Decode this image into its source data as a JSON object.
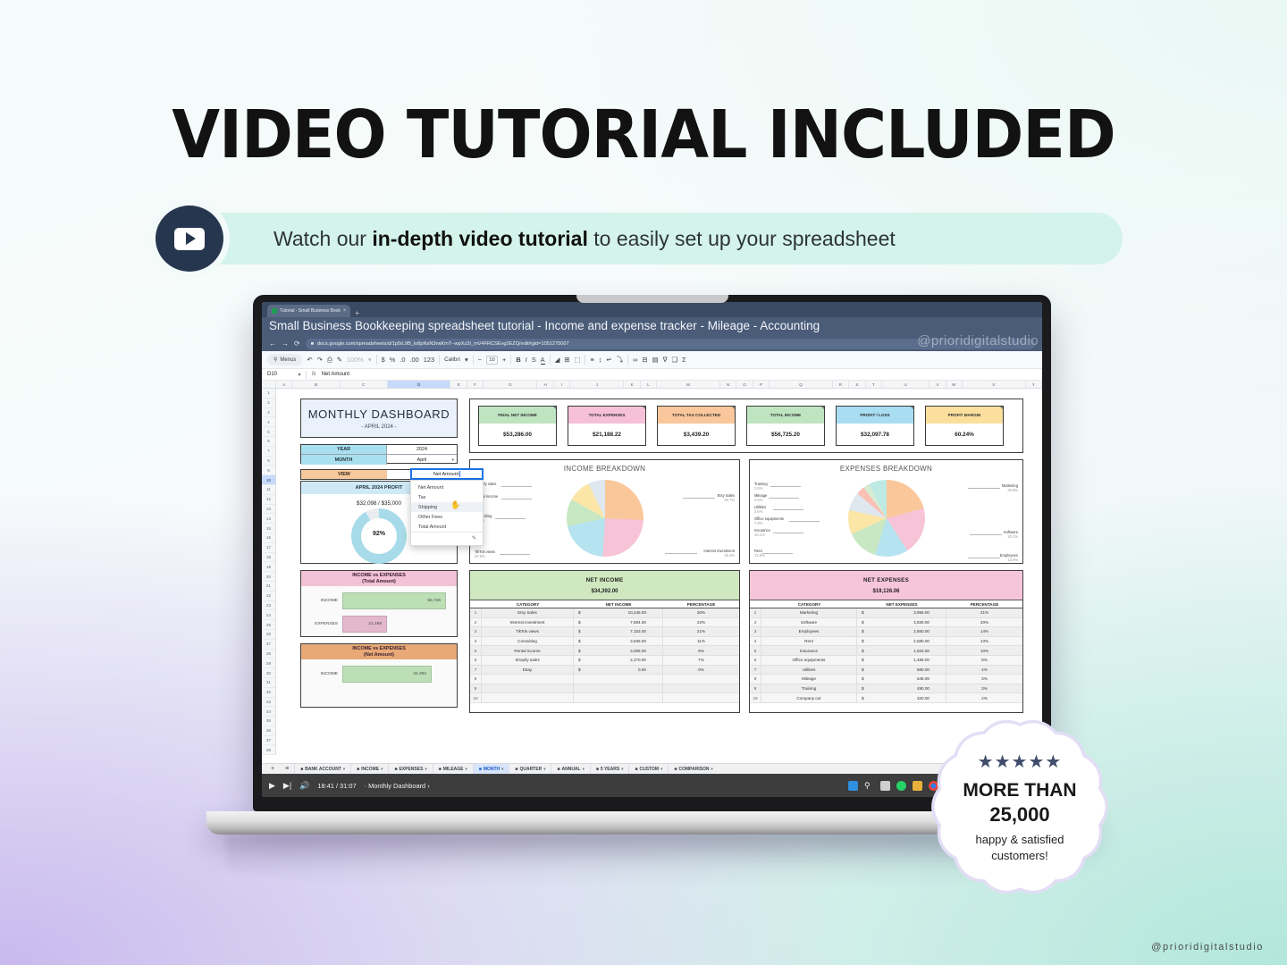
{
  "hero": {
    "headline": "VIDEO TUTORIAL INCLUDED",
    "sub_prefix": "Watch our ",
    "sub_bold": "in-depth video tutorial",
    "sub_suffix": " to easily set up your spreadsheet"
  },
  "browser": {
    "tab_label": "Tutorial - Small Business Book",
    "tab_close": "×",
    "new_tab": "+",
    "page_title": "Small Business Bookkeeping spreadsheet tutorial - Income and expense tracker - Mileage - Accounting",
    "url": "docs.google.com/spreadsheets/d/1p5rL9B_lo8pNsN3rwKmT--wpXz3I_mV4FRCSEvg2EZQ/edit#gid=1051275007",
    "back": "←",
    "forward": "→",
    "reload": "⟳",
    "watermark": "@prioridigitalstudio"
  },
  "toolbar": {
    "menus": "Menus",
    "undo": "↶",
    "redo": "↷",
    "print": "⎙",
    "paint": "✎",
    "zoom": "100%",
    "currency": "$",
    "percent": "%",
    "dec_dec": ".0",
    "dec_inc": ".00",
    "formats": "123",
    "font": "Calibri",
    "font_size": "10",
    "minus": "−",
    "plus": "+",
    "bold": "B",
    "italic": "I",
    "strike": "S",
    "text_color": "A",
    "fill_color": "◢",
    "borders": "⊞",
    "merge": "⬚",
    "valign": "≡",
    "halign": "↕",
    "wrap": "↵",
    "rotate": "⤵",
    "link": "∞",
    "comment": "⊟",
    "chart": "▤",
    "filter": "∇",
    "functions": "Σ",
    "filter_views": "❑"
  },
  "formula_bar": {
    "cell_ref": "D10",
    "caret": "▾",
    "fx": "fx",
    "value": "Net Amount"
  },
  "grid": {
    "columns": [
      "A",
      "B",
      "C",
      "D",
      "E",
      "F",
      "G",
      "H",
      "I",
      "J",
      "K",
      "L",
      "M",
      "N",
      "O",
      "P",
      "Q",
      "R",
      "S",
      "T",
      "U",
      "V",
      "W",
      "X",
      "Y"
    ],
    "selected_column": "D",
    "selected_row": 10,
    "row_count": 38
  },
  "dashboard": {
    "title": "MONTHLY DASHBOARD",
    "subtitle": "- APRIL 2024 -",
    "year_label": "YEAR",
    "year_value": "2024",
    "month_label": "MONTH",
    "month_value": "April",
    "view_label": "VIEW",
    "view_value": "Net Amount",
    "profit_header": "APRIL 2024 PROFIT",
    "profit_value": "$32,098 / $35,000",
    "profit_percent": "92%",
    "dropdown": {
      "selected": "Net Amount",
      "options": [
        "Net Amount",
        "Tax",
        "Shipping",
        "Other Fees",
        "Total Amount"
      ],
      "hovered": "Shipping",
      "edit_icon": "✎"
    }
  },
  "kpis": [
    {
      "label": "FINAL NET INCOME",
      "value": "$53,286.00",
      "color": "#bfe4c0"
    },
    {
      "label": "TOTAL EXPENSES",
      "value": "$21,188.22",
      "color": "#f6c0d8"
    },
    {
      "label": "TOTAL TAX COLLECTED",
      "value": "$3,439.20",
      "color": "#f9c79b"
    },
    {
      "label": "TOTAL INCOME",
      "value": "$56,725.20",
      "color": "#bfe4c0"
    },
    {
      "label": "PROFIT / LOSS",
      "value": "$32,097.78",
      "color": "#a9ddf2"
    },
    {
      "label": "PROFIT MARGIN",
      "value": "60.24%",
      "color": "#fadf9d"
    }
  ],
  "chart_data": [
    {
      "type": "pie",
      "title": "INCOME BREAKDOWN",
      "categories": [
        "Etsy Sales",
        "Interest investment",
        "TikTok views",
        "Consulting",
        "Rental income",
        "Shopify sales"
      ],
      "values": [
        25.7,
        25.3,
        20.6,
        11.5,
        9.8,
        7.1
      ],
      "unit": "%",
      "colors": [
        "#fac79a",
        "#f7c3d6",
        "#b6e3f0",
        "#c7e8c2",
        "#fbe6a8",
        "#dfe7ef"
      ],
      "legend": "labels-with-leader-lines"
    },
    {
      "type": "pie",
      "title": "EXPENSES BREAKDOWN",
      "categories": [
        "Marketing",
        "Software",
        "Employees",
        "Rent",
        "Insurance",
        "Office equipments",
        "Utilities",
        "Mileage",
        "Training"
      ],
      "values": [
        20.8,
        20.1,
        13.9,
        13.5,
        10.1,
        7.8,
        3.6,
        2.6,
        2.6
      ],
      "unit": "%",
      "colors": [
        "#fac79a",
        "#f7c3d6",
        "#b6e3f0",
        "#c7e8c2",
        "#fbe6a8",
        "#dfe7ef",
        "#f9c0b3",
        "#d6ecd2",
        "#bfe9e3"
      ],
      "legend": "labels-with-leader-lines"
    },
    {
      "type": "bar",
      "title": "INCOME vs EXPENSES",
      "subtitle": "(Total Amount)",
      "categories": [
        "INCOME",
        "EXPENSES"
      ],
      "values": [
        56725,
        21188
      ],
      "value_labels": [
        "56,725",
        "21,188"
      ],
      "colors": [
        "#bcdfb6",
        "#e3b8cf"
      ],
      "header_color": "#f3c2d6",
      "orientation": "horizontal"
    },
    {
      "type": "bar",
      "title": "INCOME vs EXPENSES",
      "subtitle": "(Net Amount)",
      "categories": [
        "INCOME"
      ],
      "values": [
        34392
      ],
      "value_labels": [
        "34,392"
      ],
      "colors": [
        "#bcdfb6"
      ],
      "header_color": "#e8a977",
      "orientation": "horizontal"
    }
  ],
  "net_income_table": {
    "title": "NET INCOME",
    "total": "$34,392.00",
    "header_color": "#cfe8bf",
    "columns": [
      "CATEGORY",
      "NET INCOME",
      "PERCENTAGE"
    ],
    "rows": [
      {
        "idx": "1",
        "category": "Etsy Sales",
        "currency": "$",
        "amount": "10,245.00",
        "percentage": "30%"
      },
      {
        "idx": "2",
        "category": "Interest investment",
        "currency": "$",
        "amount": "7,684.00",
        "percentage": "22%"
      },
      {
        "idx": "3",
        "category": "TikTok views",
        "currency": "$",
        "amount": "7,153.00",
        "percentage": "21%"
      },
      {
        "idx": "4",
        "category": "Consulting",
        "currency": "$",
        "amount": "3,835.00",
        "percentage": "11%"
      },
      {
        "idx": "5",
        "category": "Rental income",
        "currency": "$",
        "amount": "3,005.00",
        "percentage": "9%"
      },
      {
        "idx": "6",
        "category": "Shopify sales",
        "currency": "$",
        "amount": "2,470.00",
        "percentage": "7%"
      },
      {
        "idx": "7",
        "category": "Ebay",
        "currency": "$",
        "amount": "0.00",
        "percentage": "0%"
      },
      {
        "idx": "8",
        "category": "",
        "currency": "",
        "amount": "",
        "percentage": ""
      },
      {
        "idx": "9",
        "category": "",
        "currency": "",
        "amount": "",
        "percentage": ""
      },
      {
        "idx": "10",
        "category": "",
        "currency": "",
        "amount": "",
        "percentage": ""
      }
    ]
  },
  "net_expenses_table": {
    "title": "NET EXPENSES",
    "total": "$19,126.06",
    "header_color": "#f7c5da",
    "columns": [
      "CATEGORY",
      "NET EXPENSES",
      "PERCENTAGE"
    ],
    "rows": [
      {
        "idx": "1",
        "category": "Marketing",
        "currency": "$",
        "amount": "3,958.00",
        "percentage": "21%"
      },
      {
        "idx": "2",
        "category": "Software",
        "currency": "$",
        "amount": "3,839.00",
        "percentage": "20%"
      },
      {
        "idx": "3",
        "category": "Employees",
        "currency": "$",
        "amount": "2,650.00",
        "percentage": "14%"
      },
      {
        "idx": "4",
        "category": "Rent",
        "currency": "$",
        "amount": "2,580.00",
        "percentage": "13%"
      },
      {
        "idx": "5",
        "category": "Insurance",
        "currency": "$",
        "amount": "1,933.00",
        "percentage": "10%"
      },
      {
        "idx": "6",
        "category": "Office equipments",
        "currency": "$",
        "amount": "1,488.00",
        "percentage": "8%"
      },
      {
        "idx": "7",
        "category": "Utilities",
        "currency": "$",
        "amount": "680.00",
        "percentage": "4%"
      },
      {
        "idx": "8",
        "category": "Mileage",
        "currency": "$",
        "amount": "548.06",
        "percentage": "3%"
      },
      {
        "idx": "9",
        "category": "Training",
        "currency": "$",
        "amount": "490.00",
        "percentage": "3%"
      },
      {
        "idx": "10",
        "category": "Company car",
        "currency": "$",
        "amount": "320.00",
        "percentage": "2%"
      }
    ]
  },
  "sheet_tabs": {
    "add": "+",
    "all_sheets": "≡",
    "lock": "🔒",
    "caret": "▾",
    "items": [
      {
        "label": "BANK ACCOUNT",
        "active": false
      },
      {
        "label": "INCOME",
        "active": false
      },
      {
        "label": "EXPENSES",
        "active": false
      },
      {
        "label": "MILEAGE",
        "active": false
      },
      {
        "label": "MONTH",
        "active": true
      },
      {
        "label": "QUARTER",
        "active": false
      },
      {
        "label": "ANNUAL",
        "active": false
      },
      {
        "label": "5 YEARS",
        "active": false
      },
      {
        "label": "CUSTOM",
        "active": false
      },
      {
        "label": "COMPARISON",
        "active": false
      }
    ]
  },
  "video_player": {
    "play": "▶",
    "next": "▶|",
    "volume": "🔊",
    "time": "18:41 / 31:07",
    "chapter": "· Monthly Dashboard ›"
  },
  "taskbar": {
    "start": "start-icon",
    "search": "search-icon",
    "task_view": "task-view-icon",
    "apps": [
      "whatsapp-icon",
      "file-explorer-icon",
      "chrome-icon",
      "store-icon",
      "snip-icon",
      "chrome-icon",
      "chrome-icon",
      "chrome-icon",
      "record-icon"
    ]
  },
  "stamp": {
    "stars": "★★★★★",
    "line1": "MORE THAN",
    "line2": "25,000",
    "line3": "happy & satisfied",
    "line4": "customers!"
  },
  "footer_watermark": "@prioridigitalstudio"
}
